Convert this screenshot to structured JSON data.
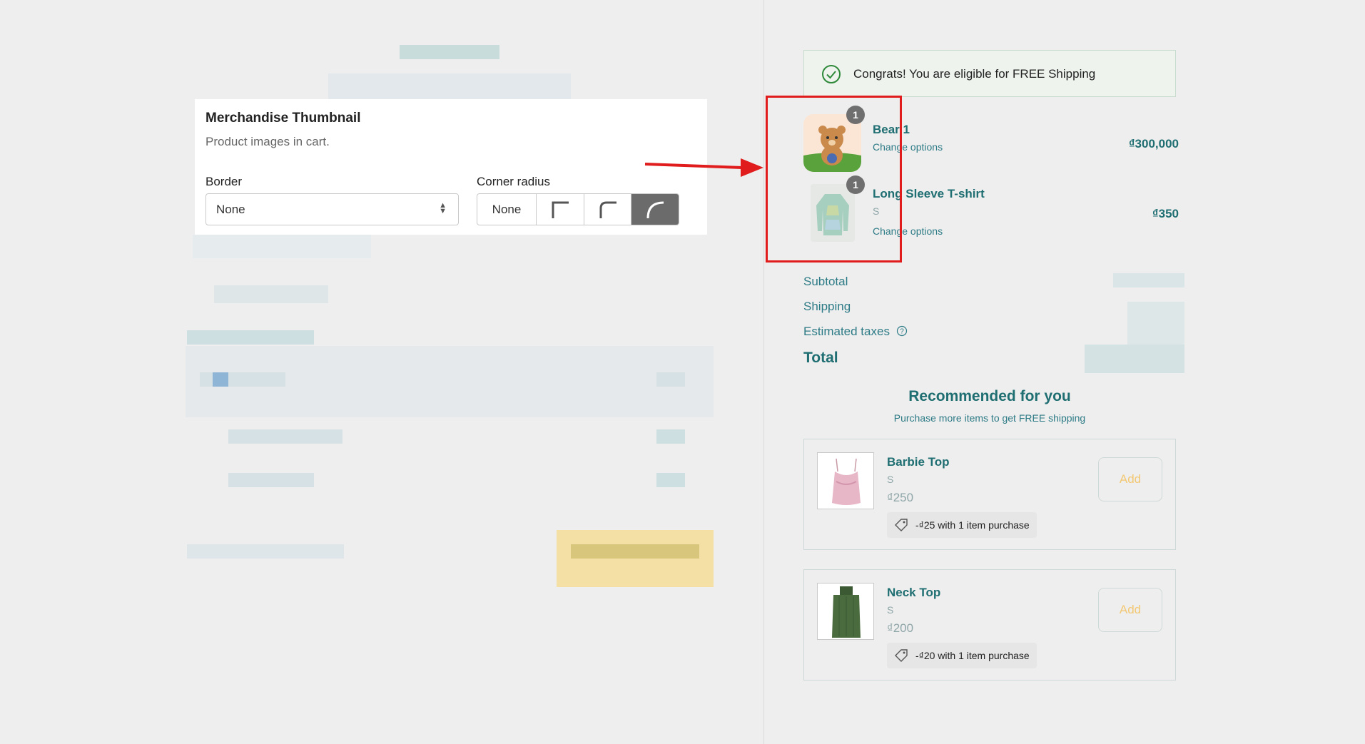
{
  "settings": {
    "title": "Merchandise Thumbnail",
    "description": "Product images in cart.",
    "border_label": "Border",
    "border_value": "None",
    "corner_label": "Corner radius",
    "corner_none_label": "None",
    "corner_selected": "large"
  },
  "shipping_banner": {
    "message": "Congrats! You are eligible for FREE Shipping"
  },
  "cart": {
    "items": [
      {
        "name": "Bear 1",
        "variant": "",
        "link": "Change options",
        "price": "₫300,000",
        "quantity": "1",
        "image": "teddy-bear-image"
      },
      {
        "name": "Long Sleeve T-shirt",
        "variant": "S",
        "link": "Change options",
        "price": "₫350",
        "quantity": "1",
        "image": "long-sleeve-shirt-image"
      }
    ]
  },
  "summary": {
    "subtotal_label": "Subtotal",
    "shipping_label": "Shipping",
    "taxes_label": "Estimated taxes",
    "total_label": "Total"
  },
  "recommendations": {
    "title": "Recommended for you",
    "subtitle": "Purchase more items to get FREE shipping",
    "items": [
      {
        "name": "Barbie Top",
        "variant": "S",
        "price": "₫250",
        "add_label": "Add",
        "discount": "-₫25 with 1 item purchase",
        "image": "pink-top-image"
      },
      {
        "name": "Neck Top",
        "variant": "S",
        "price": "₫200",
        "add_label": "Add",
        "discount": "-₫20 with 1 item purchase",
        "image": "green-top-image"
      }
    ]
  },
  "colors": {
    "accent": "#1f6e72",
    "highlight_red": "#e01c1c",
    "add_text": "#f3c873"
  }
}
